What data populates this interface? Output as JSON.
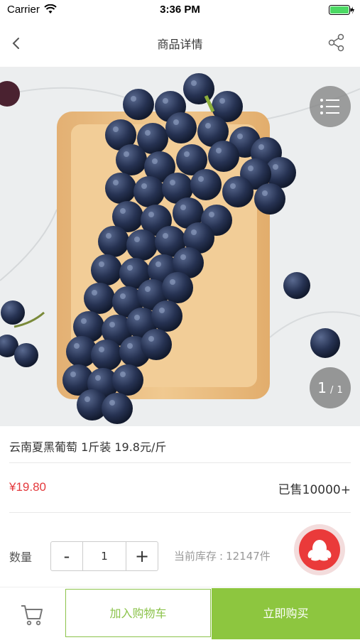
{
  "status_bar": {
    "carrier": "Carrier",
    "time": "3:36 PM"
  },
  "nav": {
    "title": "商品详情",
    "back_icon": "chevron-left-icon",
    "share_icon": "share-icon"
  },
  "gallery": {
    "current": "1",
    "separator": "/",
    "total": "1",
    "menu_icon": "list-menu-icon"
  },
  "product": {
    "title": "云南夏黑葡萄 1斤装 19.8元/斤",
    "price": "¥19.80",
    "sold": "已售10000+"
  },
  "quantity": {
    "label": "数量",
    "minus": "-",
    "value": "1",
    "plus": "+",
    "stock_label": "当前库存",
    "stock_sep": ":",
    "stock_value": "12147件"
  },
  "actions": {
    "add_to_cart": "加入购物车",
    "buy_now": "立即购买"
  },
  "colors": {
    "accent_green": "#8dc63f",
    "price_red": "#e4393c",
    "qq_red": "#ea3a3a"
  }
}
